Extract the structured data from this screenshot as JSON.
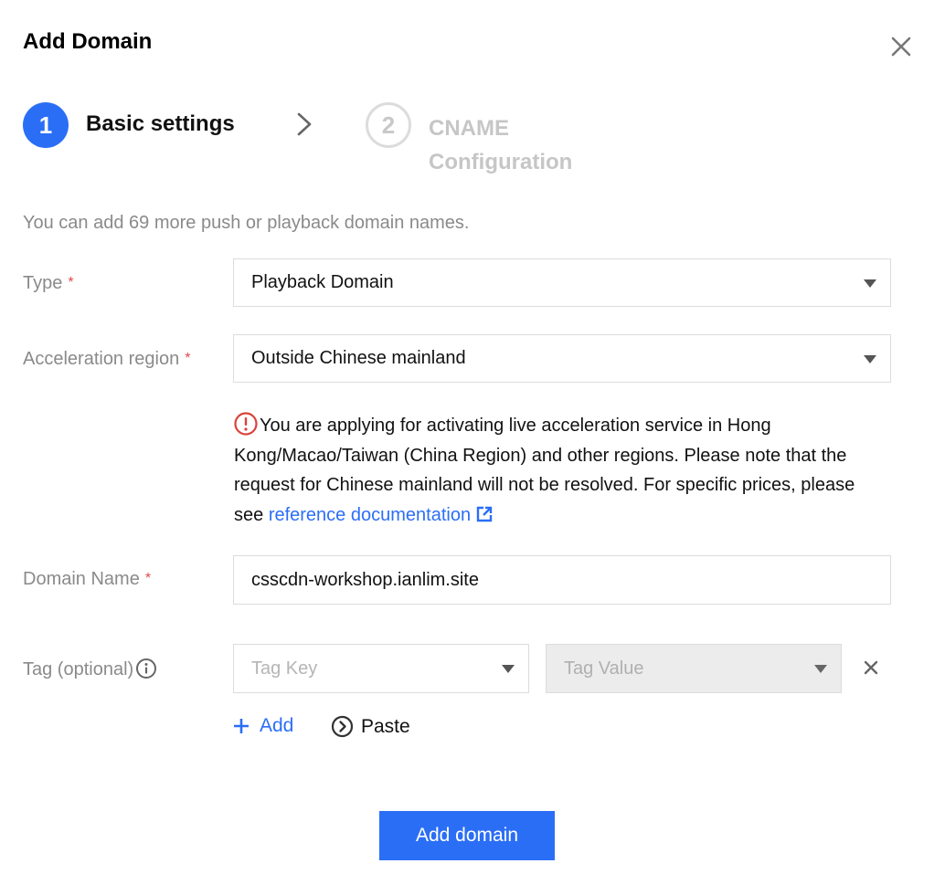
{
  "dialog": {
    "title": "Add Domain",
    "close_icon": "close-icon"
  },
  "steps": [
    {
      "number": "1",
      "label": "Basic settings",
      "state": "active"
    },
    {
      "number": "2",
      "label": "CNAME Configuration",
      "state": "inactive"
    }
  ],
  "hint": "You can add 69 more push or playback domain names.",
  "form": {
    "type": {
      "label": "Type",
      "required_mark": "*",
      "value": "Playback Domain"
    },
    "region": {
      "label": "Acceleration region",
      "required_mark": "*",
      "value": "Outside Chinese mainland"
    },
    "notice": {
      "icon": "warning-circle-icon",
      "text": "You are applying for activating live acceleration service in Hong Kong/Macao/Taiwan (China Region) and other regions. Please note that the request for Chinese mainland will not be resolved. For specific prices, please see ",
      "link_text": "reference documentation",
      "link_icon": "external-link-icon"
    },
    "domain": {
      "label": "Domain Name",
      "required_mark": "*",
      "value": "csscdn-workshop.ianlim.site"
    },
    "tag": {
      "label": "Tag (optional)",
      "info_icon": "info-icon",
      "key_placeholder": "Tag Key",
      "value_placeholder": "Tag Value",
      "remove_icon": "close-icon"
    },
    "add_label": "Add",
    "paste_label": "Paste"
  },
  "submit_label": "Add domain",
  "colors": {
    "accent": "#2b6ef6",
    "required": "#e5484d",
    "warning": "#d9433c",
    "muted_text": "#8a8a8a"
  }
}
